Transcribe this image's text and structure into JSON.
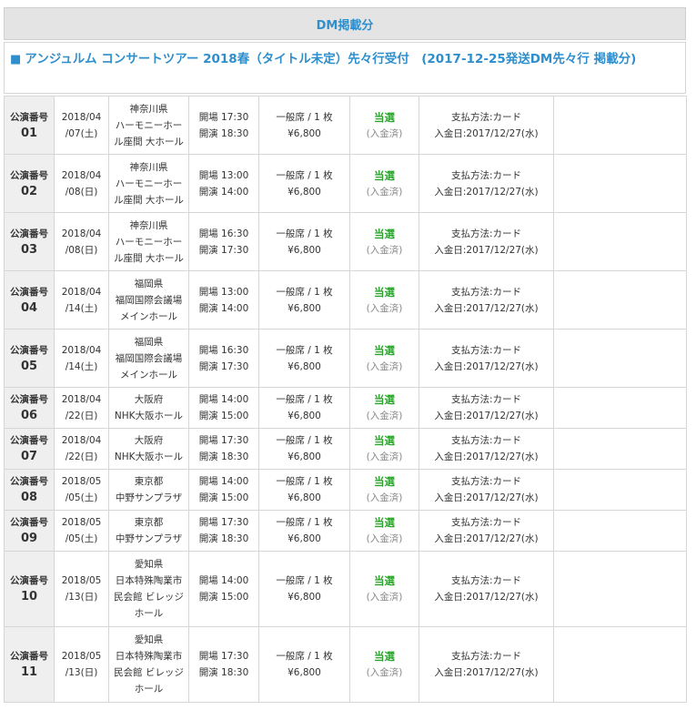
{
  "header": {
    "title": "DM掲載分"
  },
  "tour": {
    "marker": "■",
    "title": "アンジュルム コンサートツアー 2018春（タイトル未定）先々行受付　(2017-12-25発送DM先々行 掲載分)"
  },
  "performance_label": "公演番号",
  "performances": [
    {
      "num": "01",
      "date": [
        "2018/04",
        "/07(土)"
      ],
      "venue": [
        "神奈川県",
        "ハーモニーホー",
        "ル座間 大ホール"
      ],
      "open": "開場 17:30",
      "start": "開演 18:30",
      "seat": "一般席 / 1 枚",
      "price": "¥6,800",
      "result": "当選",
      "status": "(入金済)",
      "payment": "支払方法:カード",
      "paid_date": "入金日:2017/12/27(水)"
    },
    {
      "num": "02",
      "date": [
        "2018/04",
        "/08(日)"
      ],
      "venue": [
        "神奈川県",
        "ハーモニーホー",
        "ル座間 大ホール"
      ],
      "open": "開場 13:00",
      "start": "開演 14:00",
      "seat": "一般席 / 1 枚",
      "price": "¥6,800",
      "result": "当選",
      "status": "(入金済)",
      "payment": "支払方法:カード",
      "paid_date": "入金日:2017/12/27(水)"
    },
    {
      "num": "03",
      "date": [
        "2018/04",
        "/08(日)"
      ],
      "venue": [
        "神奈川県",
        "ハーモニーホー",
        "ル座間 大ホール"
      ],
      "open": "開場 16:30",
      "start": "開演 17:30",
      "seat": "一般席 / 1 枚",
      "price": "¥6,800",
      "result": "当選",
      "status": "(入金済)",
      "payment": "支払方法:カード",
      "paid_date": "入金日:2017/12/27(水)"
    },
    {
      "num": "04",
      "date": [
        "2018/04",
        "/14(土)"
      ],
      "venue": [
        "福岡県",
        "福岡国際会議場",
        "メインホール"
      ],
      "open": "開場 13:00",
      "start": "開演 14:00",
      "seat": "一般席 / 1 枚",
      "price": "¥6,800",
      "result": "当選",
      "status": "(入金済)",
      "payment": "支払方法:カード",
      "paid_date": "入金日:2017/12/27(水)"
    },
    {
      "num": "05",
      "date": [
        "2018/04",
        "/14(土)"
      ],
      "venue": [
        "福岡県",
        "福岡国際会議場",
        "メインホール"
      ],
      "open": "開場 16:30",
      "start": "開演 17:30",
      "seat": "一般席 / 1 枚",
      "price": "¥6,800",
      "result": "当選",
      "status": "(入金済)",
      "payment": "支払方法:カード",
      "paid_date": "入金日:2017/12/27(水)"
    },
    {
      "num": "06",
      "date": [
        "2018/04",
        "/22(日)"
      ],
      "venue": [
        "大阪府",
        "NHK大阪ホール"
      ],
      "open": "開場 14:00",
      "start": "開演 15:00",
      "seat": "一般席 / 1 枚",
      "price": "¥6,800",
      "result": "当選",
      "status": "(入金済)",
      "payment": "支払方法:カード",
      "paid_date": "入金日:2017/12/27(水)"
    },
    {
      "num": "07",
      "date": [
        "2018/04",
        "/22(日)"
      ],
      "venue": [
        "大阪府",
        "NHK大阪ホール"
      ],
      "open": "開場 17:30",
      "start": "開演 18:30",
      "seat": "一般席 / 1 枚",
      "price": "¥6,800",
      "result": "当選",
      "status": "(入金済)",
      "payment": "支払方法:カード",
      "paid_date": "入金日:2017/12/27(水)"
    },
    {
      "num": "08",
      "date": [
        "2018/05",
        "/05(土)"
      ],
      "venue": [
        "東京都",
        "中野サンプラザ"
      ],
      "open": "開場 14:00",
      "start": "開演 15:00",
      "seat": "一般席 / 1 枚",
      "price": "¥6,800",
      "result": "当選",
      "status": "(入金済)",
      "payment": "支払方法:カード",
      "paid_date": "入金日:2017/12/27(水)"
    },
    {
      "num": "09",
      "date": [
        "2018/05",
        "/05(土)"
      ],
      "venue": [
        "東京都",
        "中野サンプラザ"
      ],
      "open": "開場 17:30",
      "start": "開演 18:30",
      "seat": "一般席 / 1 枚",
      "price": "¥6,800",
      "result": "当選",
      "status": "(入金済)",
      "payment": "支払方法:カード",
      "paid_date": "入金日:2017/12/27(水)"
    },
    {
      "num": "10",
      "date": [
        "2018/05",
        "/13(日)"
      ],
      "venue": [
        "愛知県",
        "日本特殊陶業市",
        "民会館 ビレッジ",
        "ホール"
      ],
      "open": "開場 14:00",
      "start": "開演 15:00",
      "seat": "一般席 / 1 枚",
      "price": "¥6,800",
      "result": "当選",
      "status": "(入金済)",
      "payment": "支払方法:カード",
      "paid_date": "入金日:2017/12/27(水)"
    },
    {
      "num": "11",
      "date": [
        "2018/05",
        "/13(日)"
      ],
      "venue": [
        "愛知県",
        "日本特殊陶業市",
        "民会館 ビレッジ",
        "ホール"
      ],
      "open": "開場 17:30",
      "start": "開演 18:30",
      "seat": "一般席 / 1 枚",
      "price": "¥6,800",
      "result": "当選",
      "status": "(入金済)",
      "payment": "支払方法:カード",
      "paid_date": "入金日:2017/12/27(水)"
    }
  ],
  "colors": {
    "accent": "#2f8fcd",
    "result": "#2ea32e",
    "header_bg": "#e4e4e4",
    "num_bg": "#efefef"
  }
}
